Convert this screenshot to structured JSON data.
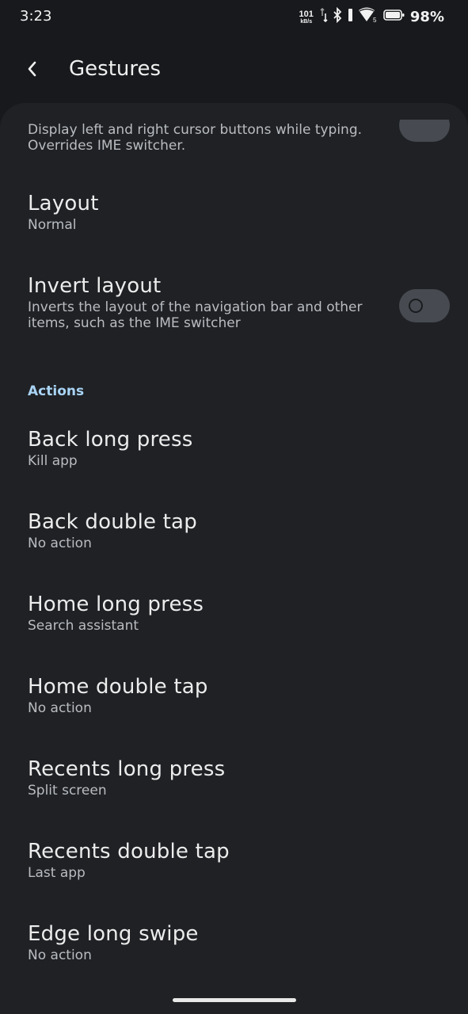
{
  "status_bar": {
    "time": "3:23",
    "net_speed_value": "101",
    "net_speed_unit": "kB/s",
    "battery_percent": "98%",
    "icons": [
      "data-arrows-icon",
      "bluetooth-icon",
      "vibrate-icon",
      "wifi-icon",
      "battery-icon"
    ]
  },
  "header": {
    "back_icon": "back-arrow-icon",
    "title": "Gestures"
  },
  "settings": {
    "cursor_item": {
      "subtitle_line1": "Display left and right cursor buttons while typing.",
      "subtitle_line2": "Overrides IME switcher."
    },
    "layout": {
      "title": "Layout",
      "subtitle": "Normal"
    },
    "invert_layout": {
      "title": "Invert layout",
      "subtitle": "Inverts the layout of the navigation bar and other items, such as the IME switcher",
      "enabled": false
    }
  },
  "actions": {
    "header": "Actions",
    "items": [
      {
        "title": "Back long press",
        "value": "Kill app"
      },
      {
        "title": "Back double tap",
        "value": "No action"
      },
      {
        "title": "Home long press",
        "value": "Search assistant"
      },
      {
        "title": "Home double tap",
        "value": "No action"
      },
      {
        "title": "Recents long press",
        "value": "Split screen"
      },
      {
        "title": "Recents double tap",
        "value": "Last app"
      },
      {
        "title": "Edge long swipe",
        "value": "No action"
      }
    ]
  },
  "colors": {
    "background": "#17191c",
    "panel": "#1f2125",
    "accent": "#a9d4f5",
    "toggle_off": "#474b51"
  }
}
